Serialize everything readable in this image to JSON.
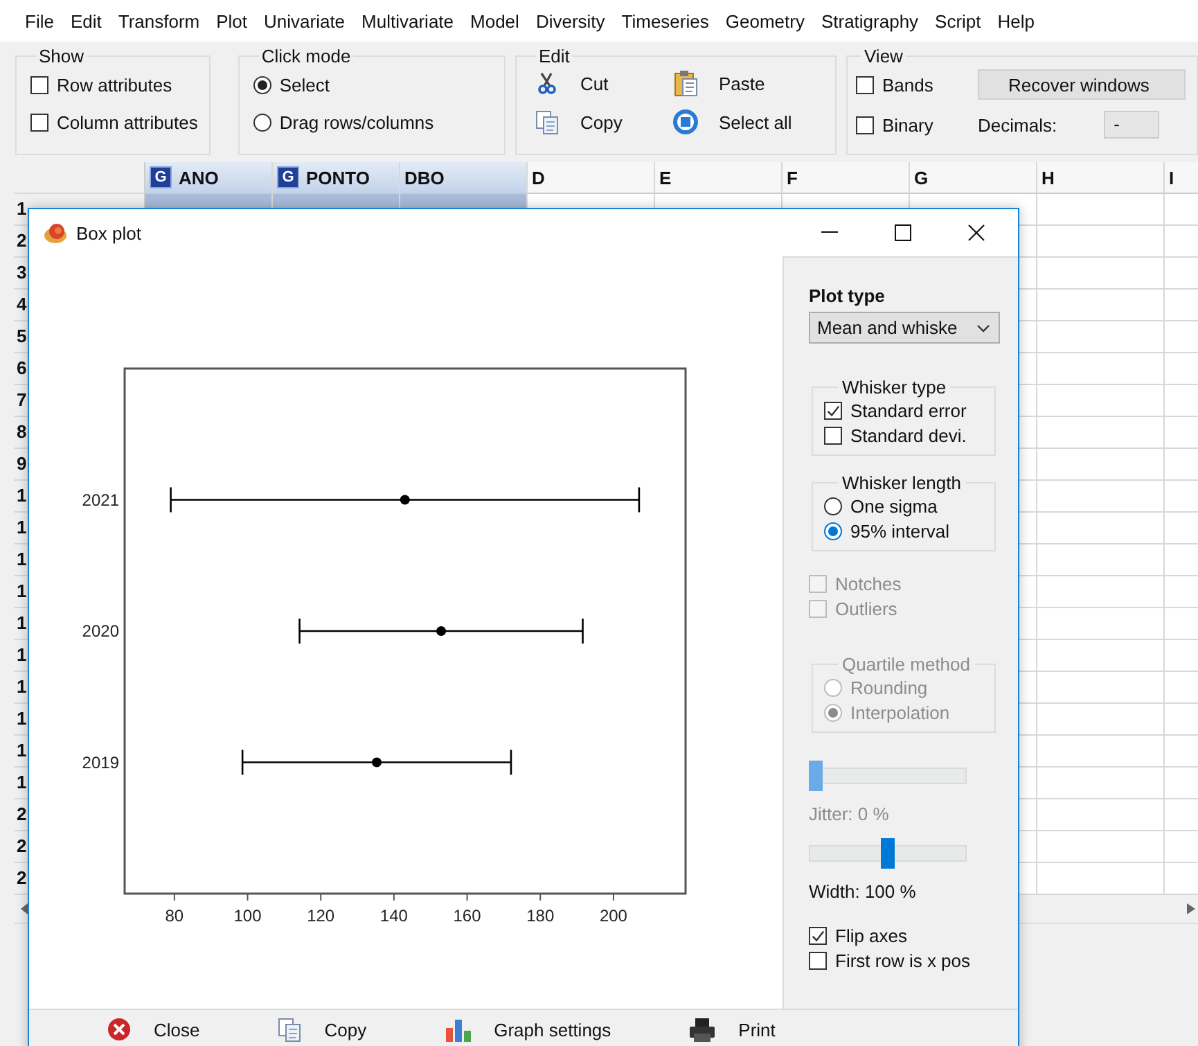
{
  "menu_bar": [
    "File",
    "Edit",
    "Transform",
    "Plot",
    "Univariate",
    "Multivariate",
    "Model",
    "Diversity",
    "Timeseries",
    "Geometry",
    "Stratigraphy",
    "Script",
    "Help"
  ],
  "toolbar": {
    "show": {
      "title": "Show",
      "options": [
        {
          "label": "Row attributes",
          "checked": false
        },
        {
          "label": "Column attributes",
          "checked": false
        }
      ]
    },
    "click_mode": {
      "title": "Click mode",
      "options": [
        {
          "label": "Select",
          "selected": true
        },
        {
          "label": "Drag rows/columns",
          "selected": false
        }
      ]
    },
    "edit": {
      "title": "Edit",
      "actions": [
        {
          "label": "Cut",
          "kind": "cut"
        },
        {
          "label": "Paste",
          "kind": "paste"
        },
        {
          "label": "Copy",
          "kind": "copy"
        },
        {
          "label": "Select all",
          "kind": "select-all"
        }
      ]
    },
    "view": {
      "title": "View",
      "options": [
        {
          "label": "Bands",
          "checked": false
        },
        {
          "label": "Binary",
          "checked": false
        }
      ],
      "recover_button": "Recover windows",
      "decimals_label": "Decimals:",
      "decimals_value": "-"
    }
  },
  "spreadsheet": {
    "columns": [
      {
        "label": "ANO",
        "badge": "G",
        "selected": true
      },
      {
        "label": "PONTO",
        "badge": "G",
        "selected": true
      },
      {
        "label": "DBO",
        "selected": true
      },
      {
        "label": "D",
        "selected": false
      },
      {
        "label": "E",
        "selected": false
      },
      {
        "label": "F",
        "selected": false
      },
      {
        "label": "G",
        "selected": false
      },
      {
        "label": "H",
        "selected": false
      },
      {
        "label": "I",
        "selected": false
      }
    ],
    "row_numbers": [
      "1",
      "2",
      "3",
      "4",
      "5",
      "6",
      "7",
      "8",
      "9",
      "1",
      "1",
      "1",
      "1",
      "1",
      "1",
      "1",
      "1",
      "1",
      "1",
      "2",
      "2",
      "2"
    ]
  },
  "dialog": {
    "title": "Box plot",
    "chart_data": {
      "type": "scatter",
      "orientation": "horizontal",
      "categories": [
        "2021",
        "2020",
        "2019"
      ],
      "xlim": [
        66.4,
        219.7
      ],
      "xticks": [
        80,
        100,
        120,
        140,
        160,
        180,
        200
      ],
      "series": [
        {
          "color": "#000000",
          "values": [
            143.0,
            152.9,
            135.3
          ],
          "errors": [
            64.0,
            38.7,
            36.7
          ]
        }
      ]
    },
    "panel": [
      {
        "kind": "heading",
        "label": "Plot type"
      },
      {
        "kind": "dropdown",
        "value": "Mean and whiske"
      },
      {
        "kind": "group",
        "title": "Whisker type",
        "disabled": false,
        "options": [
          {
            "kind": "checkbox",
            "label": "Standard error",
            "checked": true
          },
          {
            "kind": "checkbox",
            "label": "Standard devi.",
            "checked": false
          }
        ]
      },
      {
        "kind": "group",
        "title": "Whisker length",
        "disabled": false,
        "options": [
          {
            "kind": "radio",
            "label": "One sigma",
            "selected": false
          },
          {
            "kind": "radio",
            "label": "95% interval",
            "selected": true
          }
        ]
      },
      {
        "kind": "checkbox",
        "label": "Notches",
        "checked": false,
        "disabled": true
      },
      {
        "kind": "checkbox",
        "label": "Outliers",
        "checked": false,
        "disabled": true
      },
      {
        "kind": "group",
        "title": "Quartile method",
        "disabled": true,
        "options": [
          {
            "kind": "radio",
            "label": "Rounding",
            "selected": false
          },
          {
            "kind": "radio",
            "label": "Interpolation",
            "selected": true
          }
        ]
      },
      {
        "kind": "slider",
        "level": 0,
        "disabled": true,
        "caption": "Jitter: 0 %"
      },
      {
        "kind": "slider",
        "level": 0.5,
        "disabled": false,
        "caption": "Width: 100 %"
      },
      {
        "kind": "checkbox",
        "label": "Flip axes",
        "checked": true,
        "disabled": false
      },
      {
        "kind": "checkbox",
        "label": "First row is x pos",
        "checked": false,
        "disabled": false
      }
    ],
    "buttons": [
      {
        "label": "Close",
        "kind": "close"
      },
      {
        "label": "Copy",
        "kind": "copy"
      },
      {
        "label": "Graph settings",
        "kind": "graph-settings"
      },
      {
        "label": "Print",
        "kind": "print"
      }
    ]
  }
}
